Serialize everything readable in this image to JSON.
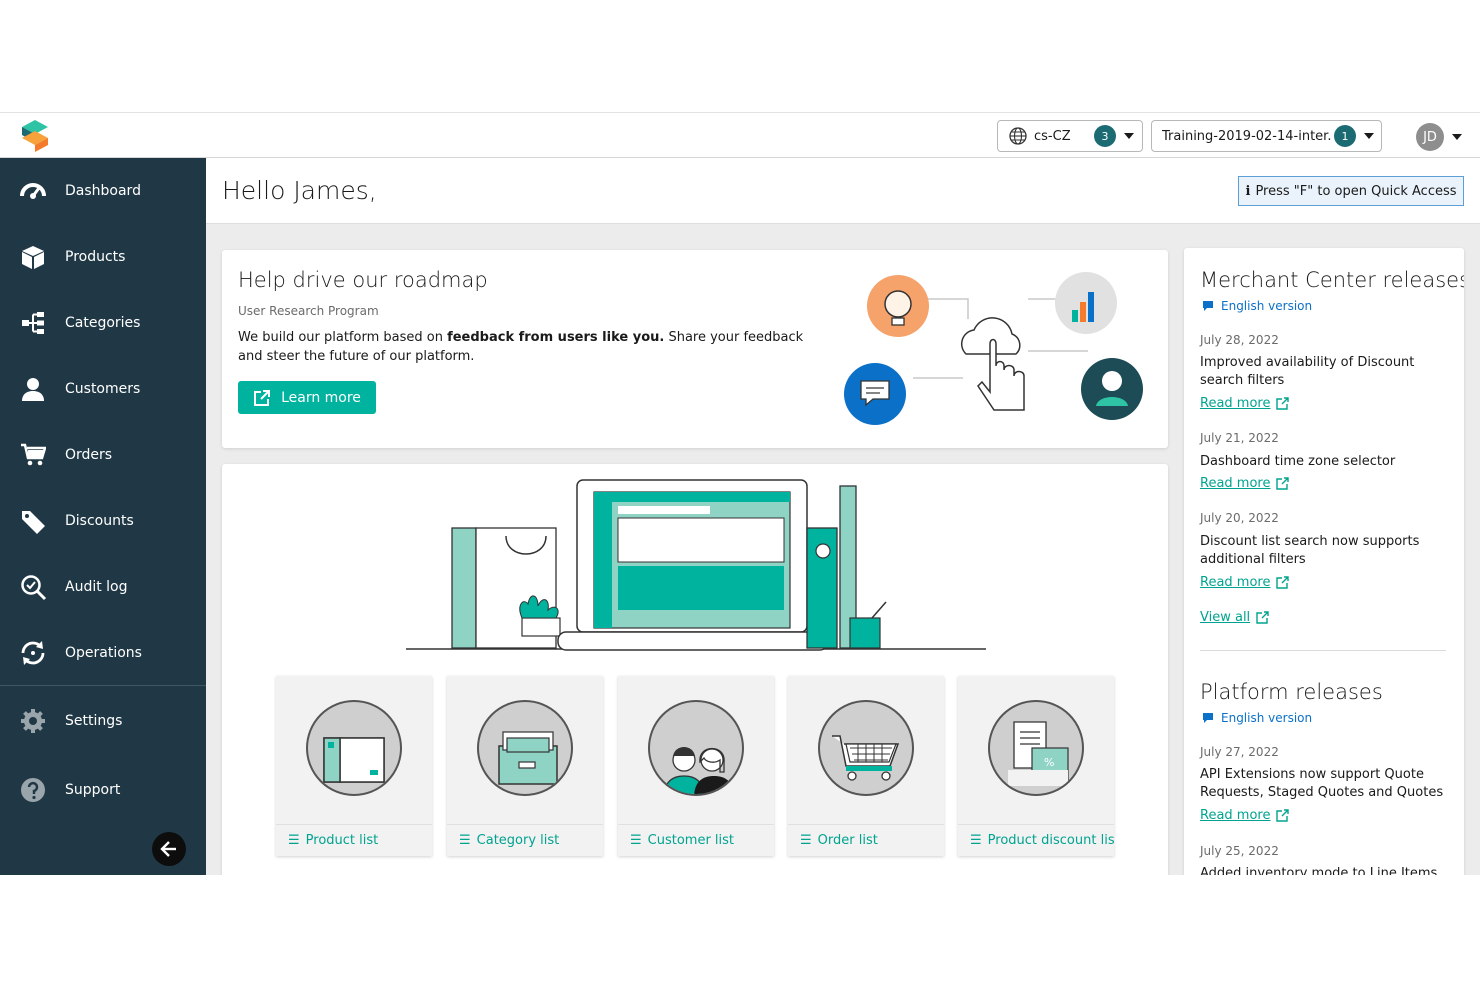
{
  "topbar": {
    "locale": "cs-CZ",
    "locale_count": "3",
    "project": "Training-2019-02-14-inter...",
    "project_count": "1",
    "user_initials": "JD"
  },
  "sidebar": {
    "items": [
      {
        "label": "Dashboard"
      },
      {
        "label": "Products"
      },
      {
        "label": "Categories"
      },
      {
        "label": "Customers"
      },
      {
        "label": "Orders"
      },
      {
        "label": "Discounts"
      },
      {
        "label": "Audit log"
      },
      {
        "label": "Operations"
      },
      {
        "label": "Settings"
      },
      {
        "label": "Support"
      }
    ]
  },
  "main": {
    "greeting": "Hello James,",
    "quick_access": "Press \"F\" to open Quick Access",
    "roadmap": {
      "title": "Help drive our roadmap",
      "subtitle": "User Research Program",
      "text_1": "We build our platform based on ",
      "text_bold": "feedback from users like you.",
      "text_2": " Share your feedback and steer the future of our platform.",
      "button": "Learn more"
    },
    "tiles": [
      {
        "label": "Product list"
      },
      {
        "label": "Category list"
      },
      {
        "label": "Customer list"
      },
      {
        "label": "Order list"
      },
      {
        "label": "Product discount list"
      }
    ]
  },
  "releases": {
    "merchant": {
      "title": "Merchant Center releases",
      "lang": "English version",
      "entries": [
        {
          "date": "July 28, 2022",
          "text": "Improved availability of Discount search filters",
          "link": "Read more"
        },
        {
          "date": "July 21, 2022",
          "text": "Dashboard time zone selector",
          "link": "Read more"
        },
        {
          "date": "July 20, 2022",
          "text": "Discount list search now supports additional filters",
          "link": "Read more"
        }
      ],
      "view_all": "View all"
    },
    "platform": {
      "title": "Platform releases",
      "lang": "English version",
      "entries": [
        {
          "date": "July 27, 2022",
          "text": "API Extensions now support Quote Requests, Staged Quotes and Quotes",
          "link": "Read more"
        },
        {
          "date": "July 25, 2022",
          "text": "Added inventory mode to Line Items"
        }
      ]
    }
  },
  "colors": {
    "sidebar": "#203845",
    "accent": "#00b39e",
    "badge": "#1d6b72",
    "link_blue": "#0b71c8"
  }
}
